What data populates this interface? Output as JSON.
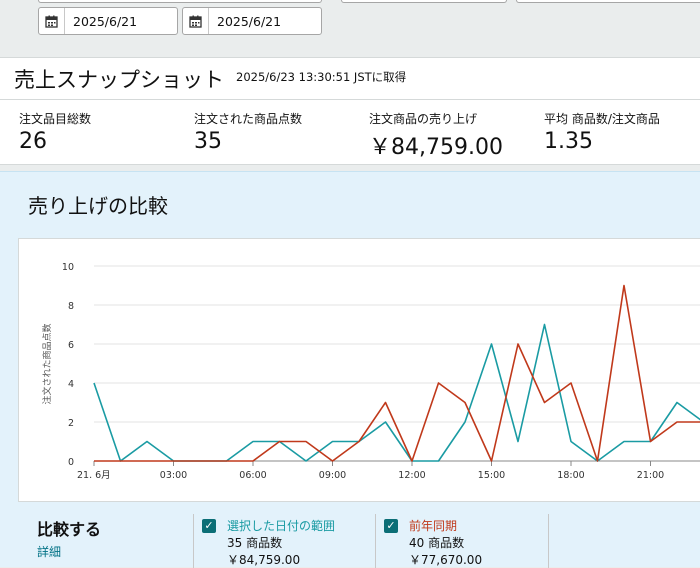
{
  "filters": {
    "start_date": "2025/6/21",
    "end_date": "2025/6/21"
  },
  "snapshot": {
    "title": "売上スナップショット",
    "timestamp": "2025/6/23 13:30:51 JSTに取得",
    "metrics": [
      {
        "label": "注文品目総数",
        "value": "26"
      },
      {
        "label": "注文された商品点数",
        "value": "35"
      },
      {
        "label": "注文商品の売り上げ",
        "value": "￥84,759.00"
      },
      {
        "label": "平均 商品数/注文商品",
        "value": "1.35"
      }
    ]
  },
  "comparison": {
    "title": "売り上げの比較",
    "compare_label": "比較する",
    "detail_link": "詳細",
    "series_legend": [
      {
        "name": "選択した日付の範囲",
        "units": "35 商品数",
        "sales": "￥84,759.00",
        "color": "#1a9ba3",
        "checked": true
      },
      {
        "name": "前年同期",
        "units": "40 商品数",
        "sales": "￥77,670.00",
        "color": "#c0391b",
        "checked": true
      }
    ]
  },
  "chart_data": {
    "type": "line",
    "ylabel": "注文された商品点数",
    "ylim": [
      0,
      10
    ],
    "yticks": [
      "0",
      "2",
      "4",
      "6",
      "8",
      "10"
    ],
    "xticks": [
      "21. 6月",
      "03:00",
      "06:00",
      "09:00",
      "12:00",
      "15:00",
      "18:00",
      "21:00"
    ],
    "x": [
      0,
      1,
      2,
      3,
      4,
      5,
      6,
      7,
      8,
      9,
      10,
      11,
      12,
      13,
      14,
      15,
      16,
      17,
      18,
      19,
      20,
      21,
      22,
      23
    ],
    "series": [
      {
        "name": "選択した日付の範囲",
        "color": "#1a9ba3",
        "values": [
          4,
          0,
          1,
          0,
          0,
          0,
          1,
          1,
          0,
          1,
          1,
          2,
          0,
          0,
          2,
          6,
          1,
          7,
          1,
          0,
          1,
          1,
          3,
          2
        ]
      },
      {
        "name": "前年同期",
        "color": "#c0391b",
        "values": [
          0,
          0,
          0,
          0,
          0,
          0,
          0,
          1,
          1,
          0,
          1,
          3,
          0,
          4,
          3,
          0,
          6,
          3,
          4,
          0,
          9,
          1,
          2,
          2
        ]
      }
    ],
    "grid": true
  },
  "colors": {
    "accent_teal": "#1a9ba3",
    "accent_red": "#c0391b",
    "link": "#007185",
    "panel_bg": "#e3f2fb"
  }
}
